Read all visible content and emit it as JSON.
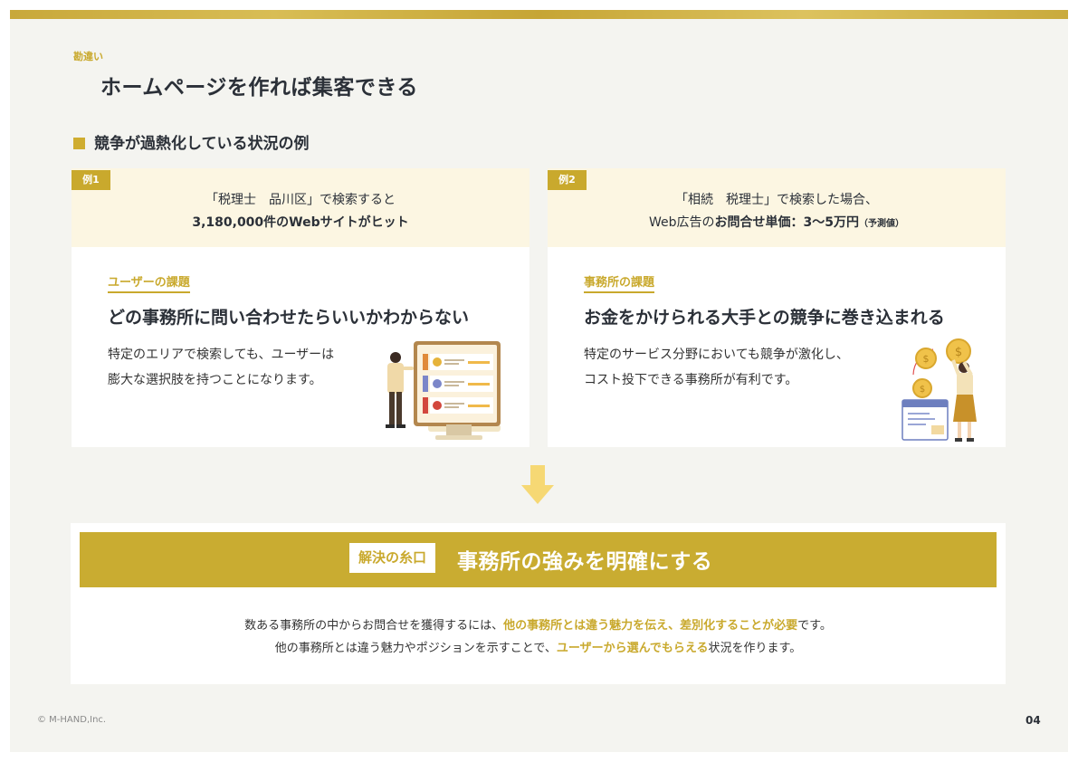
{
  "kicker": "勘違い",
  "title": "ホームページを作れば集客できる",
  "section_title": "競争が過熱化している状況の例",
  "examples": [
    {
      "tag": "例1",
      "head_line1": "「税理士　品川区」で検索すると",
      "head_line2": "3,180,000件のWebサイトがヒット",
      "sub_label": "ユーザーの課題",
      "big_text": "どの事務所に問い合わせたらいいかわからない",
      "body_line1": "特定のエリアで検索しても、ユーザーは",
      "body_line2": "膨大な選択肢を持つことになります。",
      "icon": "user-choosing-from-list-illustration"
    },
    {
      "tag": "例2",
      "head_line1": "「相続　税理士」で検索した場合、",
      "head_line2_prefix": "Web広告の",
      "head_line2_bold": "お問合せ単価：3〜5万円",
      "head_line2_small": "（予測値）",
      "sub_label": "事務所の課題",
      "big_text": "お金をかけられる大手との競争に巻き込まれる",
      "body_line1": "特定のサービス分野においても競争が激化し、",
      "body_line2": "コスト投下できる事務所が有利です。",
      "icon": "person-holding-coins-illustration"
    }
  ],
  "solution": {
    "badge": "解決の糸口",
    "title": "事務所の強みを明確にする",
    "line1_a": "数ある事務所の中からお問合せを獲得するには、",
    "line1_hl": "他の事務所とは違う魅力を伝え、差別化することが必要",
    "line1_b": "です。",
    "line2_a": "他の事務所とは違う魅力やポジションを示すことで、",
    "line2_hl": "ユーザーから選んでもらえる",
    "line2_b": "状況を作ります。"
  },
  "footer": {
    "copyright": "© M-HAND,Inc.",
    "page": "04"
  },
  "colors": {
    "accent": "#c9a92d",
    "banner": "#c9ac31",
    "arrow": "#f6d874",
    "card_head": "#fcf6e2",
    "background": "#f4f4f0",
    "text": "#2b3038"
  }
}
